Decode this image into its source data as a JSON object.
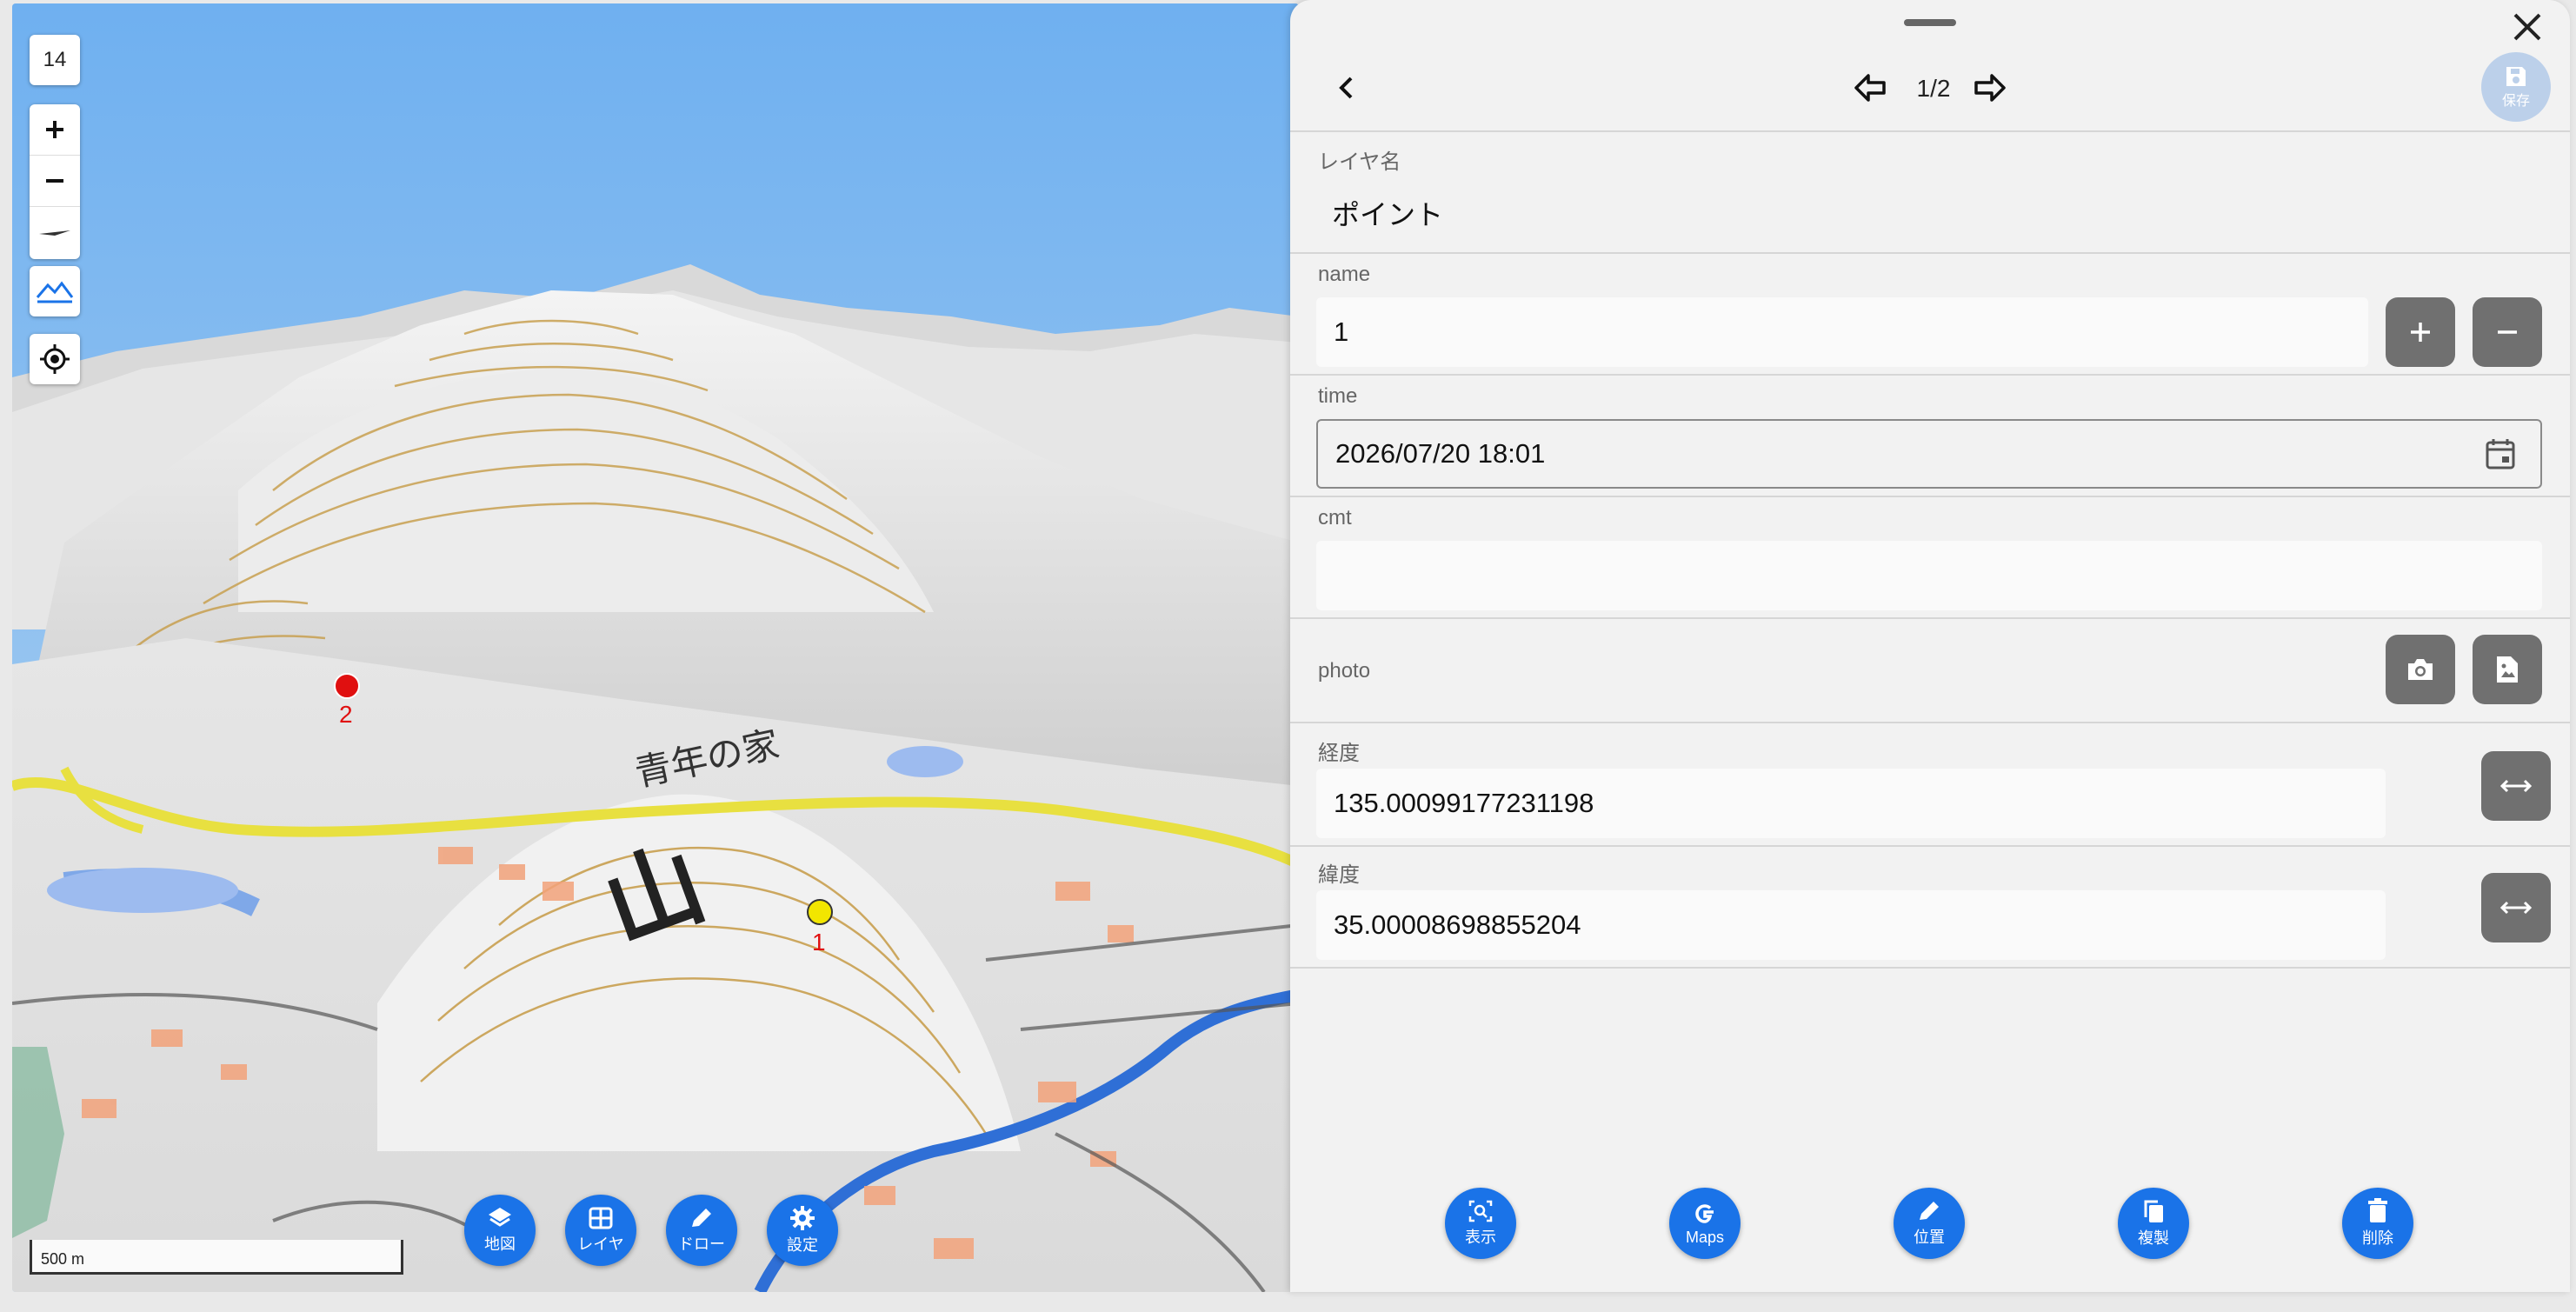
{
  "map": {
    "zoom_level": "14",
    "zoom_in_label": "+",
    "zoom_out_label": "−",
    "scale_label": "500 m",
    "place_labels": [
      "青年の家",
      "山"
    ],
    "markers": [
      {
        "label": "2",
        "color": "#e01010"
      },
      {
        "label": "1",
        "color": "#f2e600"
      }
    ],
    "toolbar": [
      {
        "label": "地図",
        "icon": "layers-icon"
      },
      {
        "label": "レイヤ",
        "icon": "grid-icon"
      },
      {
        "label": "ドロー",
        "icon": "pencil-icon"
      },
      {
        "label": "設定",
        "icon": "gear-icon"
      }
    ]
  },
  "panel": {
    "page_indicator": "1/2",
    "save_label": "保存",
    "fields": {
      "layer_name": {
        "label": "レイヤ名",
        "value": "ポイント"
      },
      "name": {
        "label": "name",
        "value": "1"
      },
      "time": {
        "label": "time",
        "value": "2026/07/20 18:01"
      },
      "cmt": {
        "label": "cmt",
        "value": ""
      },
      "photo": {
        "label": "photo"
      },
      "longitude": {
        "label": "経度",
        "value": "135.00099177231198"
      },
      "latitude": {
        "label": "緯度",
        "value": "35.00008698855204"
      }
    },
    "bottom_actions": [
      {
        "label": "表示",
        "icon": "zoom-to-icon"
      },
      {
        "label": "Maps",
        "icon": "google-icon"
      },
      {
        "label": "位置",
        "icon": "pencil-icon"
      },
      {
        "label": "複製",
        "icon": "copy-icon"
      },
      {
        "label": "削除",
        "icon": "trash-icon"
      }
    ]
  },
  "colors": {
    "accent": "#1a73e8",
    "sky": "#7fb8ee",
    "contour": "#c8a050",
    "road": "#e8e040"
  }
}
